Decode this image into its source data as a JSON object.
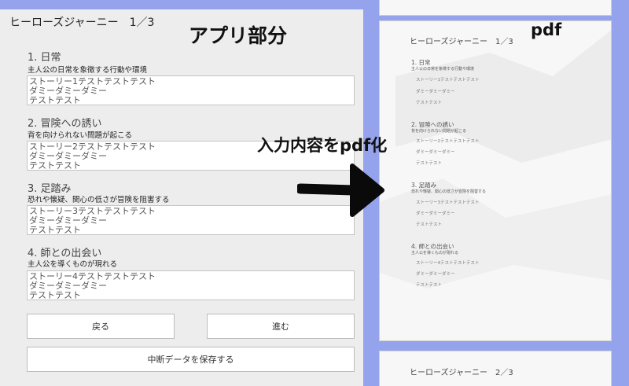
{
  "app": {
    "title": "ヒーローズジャーニー　1／3",
    "caption": "アプリ部分",
    "sections": [
      {
        "heading": "1. 日常",
        "description": "主人公の日常を象徴する行動や環境",
        "value": "ストーリー1テストテストテスト\nダミーダミーダミー\nテストテスト"
      },
      {
        "heading": "2. 冒険への誘い",
        "description": "背を向けられない問題が起こる",
        "value": "ストーリー2テストテストテスト\nダミーダミーダミー\nテストテスト"
      },
      {
        "heading": "3. 足踏み",
        "description": "恐れや懐疑、関心の低さが冒険を阻害する",
        "value": "ストーリー3テストテストテスト\nダミーダミーダミー\nテストテスト"
      },
      {
        "heading": "4. 師との出会い",
        "description": "主人公を導くものが現れる",
        "value": "ストーリー4テストテストテスト\nダミーダミーダミー\nテストテスト"
      }
    ],
    "buttons": {
      "back": "戻る",
      "next": "進む",
      "save": "中断データを保存する"
    }
  },
  "pdf": {
    "caption": "pdf",
    "page1_title": "ヒーローズジャーニー　1／3",
    "page2_title": "ヒーローズジャーニー　2／3",
    "sections": [
      {
        "heading": "1. 日常",
        "description": "主人公の日常を象徴する行動や環境",
        "lines": [
          "ストーリー1テストテストテスト",
          "ダミーダミーダミー",
          "テストテスト"
        ]
      },
      {
        "heading": "2. 冒険への誘い",
        "description": "背を向けられない問題が起こる",
        "lines": [
          "ストーリー2テストテストテスト",
          "ダミーダミーダミー",
          "テストテスト"
        ]
      },
      {
        "heading": "3. 足踏み",
        "description": "恐れや懐疑、関心の低さが冒険を阻害する",
        "lines": [
          "ストーリー3テストテストテスト",
          "ダミーダミーダミー",
          "テストテスト"
        ]
      },
      {
        "heading": "4. 師との出会い",
        "description": "主人公を導くものが現れる",
        "lines": [
          "ストーリー4テストテストテスト",
          "ダミーダミーダミー",
          "テストテスト"
        ]
      }
    ]
  },
  "overlay": {
    "convert_caption": "入力内容をpdf化",
    "arrow_icon": "right-arrow-icon"
  },
  "colors": {
    "background": "#94a3ec",
    "app_panel": "#ededed",
    "pdf_page": "#f7f7f7"
  }
}
